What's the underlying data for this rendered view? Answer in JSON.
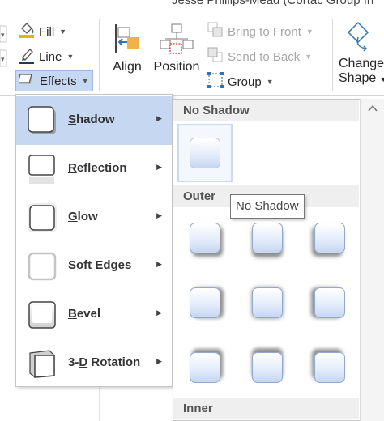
{
  "window": {
    "user_name": "Jesse Phillips-Mead (Cortac Group In"
  },
  "ribbon": {
    "fill": {
      "label": "Fill",
      "icon": "paint-bucket-icon"
    },
    "line": {
      "label": "Line",
      "icon": "pen-line-icon"
    },
    "effects": {
      "label": "Effects",
      "icon": "effects-icon"
    },
    "align": {
      "label": "Align",
      "icon": "align-icon"
    },
    "position": {
      "label": "Position",
      "icon": "position-icon"
    },
    "bring_to_front": {
      "label": "Bring to Front",
      "icon": "bring-to-front-icon"
    },
    "send_to_back": {
      "label": "Send to Back",
      "icon": "send-to-back-icon"
    },
    "group": {
      "label": "Group",
      "icon": "group-icon"
    },
    "change_shape": {
      "label1": "Change",
      "label2": "Shape",
      "icon": "change-shape-icon"
    }
  },
  "effects_menu": {
    "items": [
      {
        "pre": "",
        "ul": "S",
        "post": "hadow"
      },
      {
        "pre": "",
        "ul": "R",
        "post": "eflection"
      },
      {
        "pre": "",
        "ul": "G",
        "post": "low"
      },
      {
        "pre": "Soft ",
        "ul": "E",
        "post": "dges"
      },
      {
        "pre": "",
        "ul": "B",
        "post": "evel"
      },
      {
        "pre": "3-",
        "ul": "D",
        "post": " Rotation"
      }
    ]
  },
  "gallery": {
    "headers": {
      "none": "No Shadow",
      "outer": "Outer",
      "inner": "Inner"
    }
  },
  "tooltip": {
    "text": "No Shadow"
  },
  "colors": {
    "accent": "#c5d7f1",
    "shape_border": "#8fa9cf"
  }
}
